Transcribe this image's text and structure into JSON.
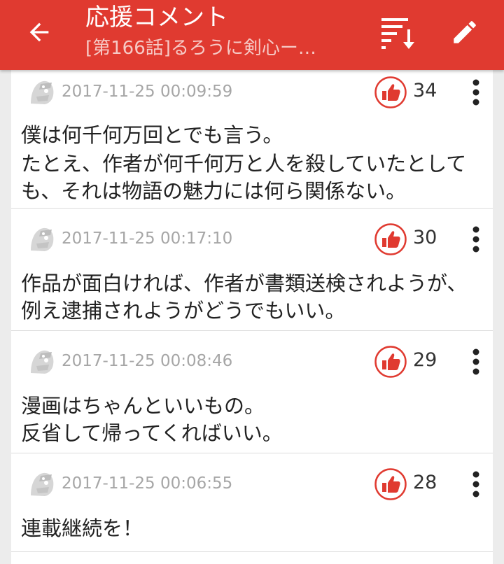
{
  "header": {
    "title": "応援コメント",
    "subtitle": "[第166話]るろうに剣心ー…",
    "bar_color": "#e03a30"
  },
  "icons": {
    "back": "arrow-back-icon",
    "sort": "sort-icon",
    "edit": "pencil-icon",
    "avatar": "default-avatar-icon",
    "like": "thumbs-up-icon",
    "more": "more-vert-icon"
  },
  "comments": [
    {
      "date": "2017-11-25 00:09:59",
      "likes": "34",
      "lines": [
        "僕は何千何万回とでも言う。",
        "たとえ、作者が何千何万と人を殺していたとして",
        "も、それは物語の魅力には何ら関係ない。"
      ]
    },
    {
      "date": "2017-11-25 00:17:10",
      "likes": "30",
      "lines": [
        "作品が面白ければ、作者が書類送検されようが、",
        "例え逮捕されようがどうでもいい。"
      ]
    },
    {
      "date": "2017-11-25 00:08:46",
      "likes": "29",
      "lines": [
        "漫画はちゃんといいもの。",
        "反省して帰ってくればいい。"
      ]
    },
    {
      "date": "2017-11-25 00:06:55",
      "likes": "28",
      "lines": [
        "連載継続を！"
      ]
    }
  ]
}
